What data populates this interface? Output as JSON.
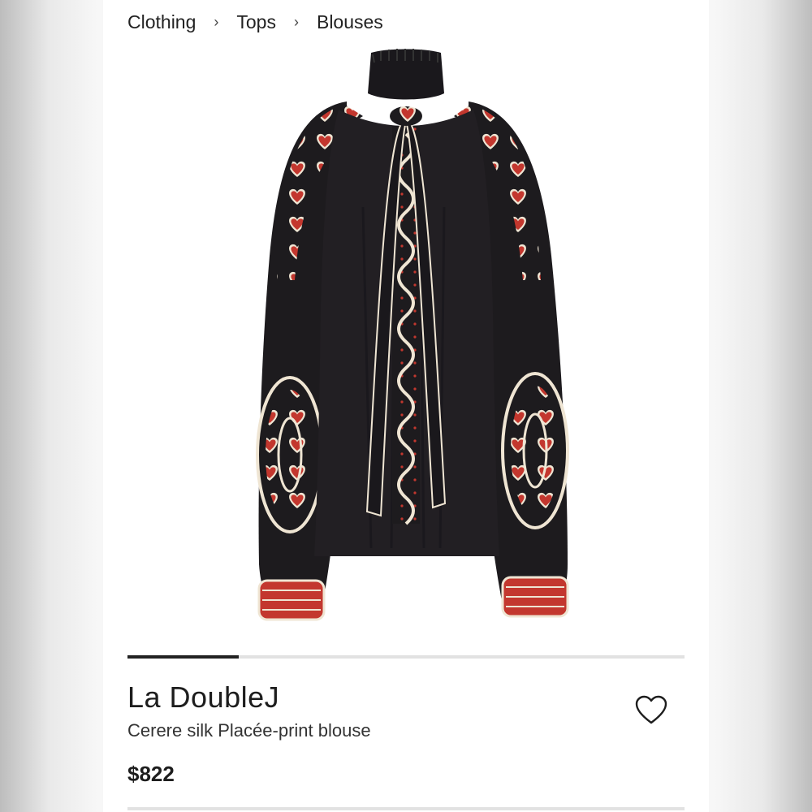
{
  "breadcrumb": {
    "items": [
      "Clothing",
      "Tops",
      "Blouses"
    ],
    "separator": "›"
  },
  "gallery": {
    "progress": 0.2,
    "image_alt": "black silk blouse with red heart print"
  },
  "product": {
    "brand": "La DoubleJ",
    "title": "Cerere silk Placée-print blouse",
    "price": "$822",
    "favorite_icon": "heart-outline-icon"
  },
  "colors": {
    "fabric": "#1d1b1e",
    "print_red": "#c3372e",
    "print_cream": "#efe5d3"
  }
}
